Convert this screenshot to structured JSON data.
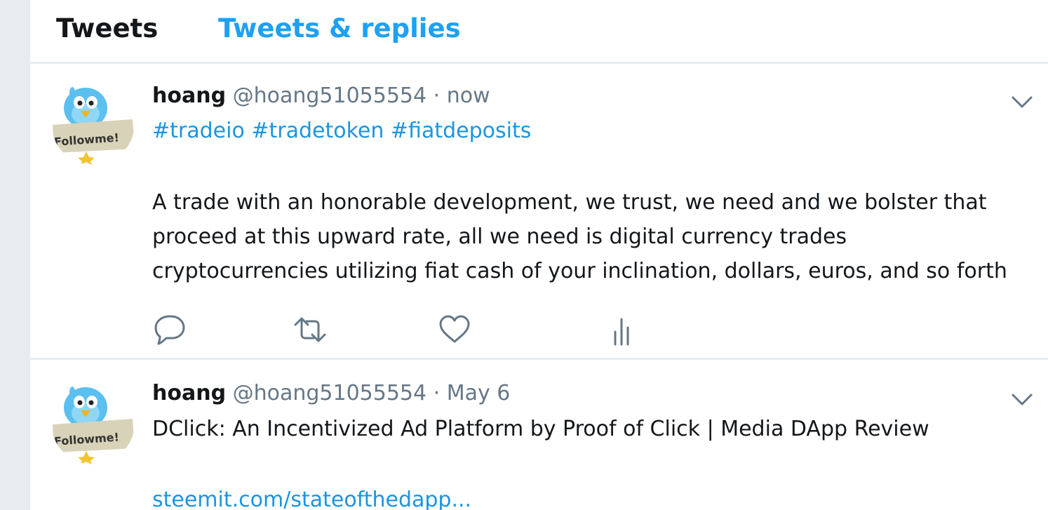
{
  "tabs": {
    "tweets": "Tweets",
    "tweets_replies": "Tweets & replies"
  },
  "colors": {
    "accent": "#1da1f2",
    "link": "#1b95e0",
    "muted": "#657786",
    "divider": "#e6ecf0"
  },
  "tweets": [
    {
      "name": "hoang",
      "handle": "@hoang51055554",
      "separator": "·",
      "time": "now",
      "hashtags": [
        "#tradeio",
        "#tradetoken",
        "#fiatdeposits"
      ],
      "body_lines": [
        "A trade with an honorable development, we trust, we need and we bolster that",
        "proceed at this upward rate, all we need is digital currency trades",
        "cryptocurrencies utilizing fiat cash of your inclination, dollars, euros, and so forth"
      ],
      "avatar_text": "Followme!",
      "actions": [
        "reply-icon",
        "retweet-icon",
        "like-icon",
        "analytics-icon"
      ]
    },
    {
      "name": "hoang",
      "handle": "@hoang51055554",
      "separator": "·",
      "time": "May 6",
      "body_lines": [
        "DClick: An Incentivized Ad Platform by Proof of Click | Media DApp Review"
      ],
      "link": "steemit.com/stateofthedapp...",
      "avatar_text": "Followme!"
    }
  ]
}
